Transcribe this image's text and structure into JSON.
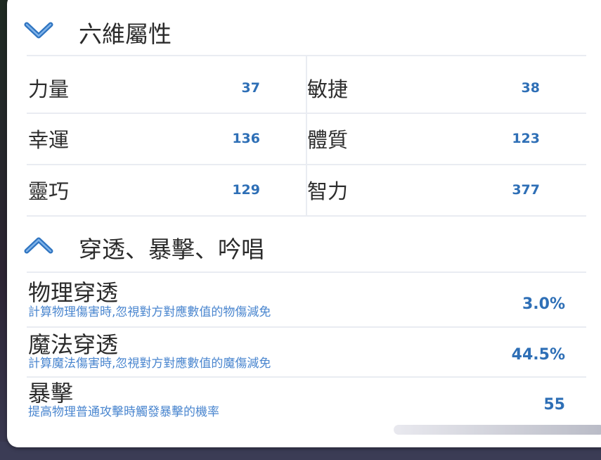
{
  "section1": {
    "title": "六維屬性",
    "icon": "chevron-down-icon",
    "stats": [
      {
        "label": "力量",
        "value": "37"
      },
      {
        "label": "敏捷",
        "value": "38"
      },
      {
        "label": "幸運",
        "value": "136"
      },
      {
        "label": "體質",
        "value": "123"
      },
      {
        "label": "靈巧",
        "value": "129"
      },
      {
        "label": "智力",
        "value": "377"
      }
    ]
  },
  "section2": {
    "title": "穿透、暴擊、吟唱",
    "icon": "chevron-up-icon",
    "rows": [
      {
        "title": "物理穿透",
        "desc": "計算物理傷害時,忽視對方對應數值的物傷減免",
        "value": "3.0%"
      },
      {
        "title": "魔法穿透",
        "desc": "計算魔法傷害時,忽視對方對應數值的魔傷減免",
        "value": "44.5%"
      },
      {
        "title": "暴擊",
        "desc": "提高物理普通攻擊時觸發暴擊的機率",
        "value": "55"
      }
    ]
  },
  "colors": {
    "accent": "#2e6fb6",
    "desc_text": "#4a86cf",
    "divider": "#e9ecf2"
  }
}
